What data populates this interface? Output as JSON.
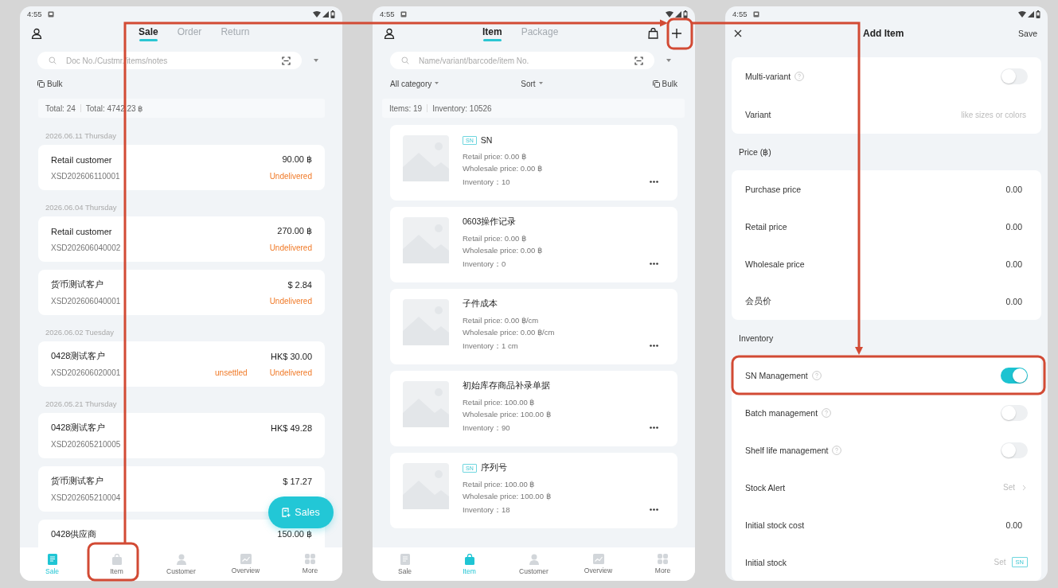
{
  "sales_screen": {
    "status_time": "4:55",
    "tabs": [
      {
        "label": "Sale",
        "selected": true
      },
      {
        "label": "Order",
        "selected": false
      },
      {
        "label": "Return",
        "selected": false
      }
    ],
    "search_placeholder": "Doc No./Custmr./items/notes",
    "bulk": "Bulk",
    "summary": [
      "Total: 24",
      "Total: 4742.23 ฿"
    ],
    "groups": [
      {
        "date": "2026.06.11 Thursday",
        "orders": [
          {
            "customer": "Retail customer",
            "amount": "90.00 ฿",
            "number": "XSD202606110001",
            "statuses": [
              "Undelivered"
            ]
          }
        ]
      },
      {
        "date": "2026.06.04 Thursday",
        "orders": [
          {
            "customer": "Retail customer",
            "amount": "270.00 ฿",
            "number": "XSD202606040002",
            "statuses": [
              "Undelivered"
            ]
          },
          {
            "customer": "货币测试客户",
            "amount": "$ 2.84",
            "number": "XSD202606040001",
            "statuses": [
              "Undelivered"
            ]
          }
        ]
      },
      {
        "date": "2026.06.02 Tuesday",
        "orders": [
          {
            "customer": "0428测试客户",
            "amount": "HK$ 30.00",
            "number": "XSD202606020001",
            "statuses": [
              "unsettled",
              "Undelivered"
            ]
          }
        ]
      },
      {
        "date": "2026.05.21 Thursday",
        "orders": [
          {
            "customer": "0428测试客户",
            "amount": "HK$ 49.28",
            "number": "XSD202605210005"
          },
          {
            "customer": "货币测试客户",
            "amount": "$ 17.27",
            "number": "XSD202605210004"
          },
          {
            "customer": "0428供应商",
            "amount": "150.00 ฿"
          }
        ]
      }
    ],
    "fab": "Sales",
    "nav": [
      {
        "label": "Sale",
        "selected": true
      },
      {
        "label": "Item",
        "selected": false
      },
      {
        "label": "Customer",
        "selected": false
      },
      {
        "label": "Overview",
        "selected": false
      },
      {
        "label": "More",
        "selected": false
      }
    ]
  },
  "items_screen": {
    "status_time": "4:55",
    "tabs": [
      {
        "label": "Item",
        "selected": true
      },
      {
        "label": "Package",
        "selected": false
      }
    ],
    "search_placeholder": "Name/variant/barcode/item No.",
    "filters": [
      "All category",
      "Sort"
    ],
    "bulk": "Bulk",
    "summary": [
      "Items: 19",
      "Inventory: 10526"
    ],
    "items": [
      {
        "badge": "SN",
        "name": "SN",
        "retail": "Retail price: 0.00 ฿",
        "wholesale": "Wholesale price: 0.00 ฿",
        "inventory": "Inventory：10"
      },
      {
        "name": "0603操作记录",
        "retail": "Retail price: 0.00 ฿",
        "wholesale": "Wholesale price: 0.00 ฿",
        "inventory": "Inventory：0"
      },
      {
        "name": "子件成本",
        "retail": "Retail price: 0.00 ฿/cm",
        "wholesale": "Wholesale price: 0.00 ฿/cm",
        "inventory": "Inventory：1 cm"
      },
      {
        "name": "初始库存商品补录单据",
        "retail": "Retail price: 100.00 ฿",
        "wholesale": "Wholesale price: 100.00 ฿",
        "inventory": "Inventory：90"
      },
      {
        "badge": "SN",
        "name": "序列号",
        "retail": "Retail price: 100.00 ฿",
        "wholesale": "Wholesale price: 100.00 ฿",
        "inventory": "Inventory：18"
      }
    ],
    "nav": [
      {
        "label": "Sale",
        "selected": false
      },
      {
        "label": "Item",
        "selected": true
      },
      {
        "label": "Customer",
        "selected": false
      },
      {
        "label": "Overview",
        "selected": false
      },
      {
        "label": "More",
        "selected": false
      }
    ]
  },
  "add_item_screen": {
    "status_time": "4:55",
    "title": "Add Item",
    "save": "Save",
    "sections": [
      {
        "rows": [
          {
            "kind": "toggle",
            "label": "Multi-variant",
            "help": true,
            "on": false
          },
          {
            "kind": "input",
            "label": "Variant",
            "help": false,
            "placeholder": "like sizes or colors"
          }
        ]
      },
      {
        "heading": "Price (฿)",
        "rows": [
          {
            "kind": "value",
            "label": "Purchase price",
            "help": false,
            "value": "0.00"
          },
          {
            "kind": "value",
            "label": "Retail price",
            "help": false,
            "value": "0.00"
          },
          {
            "kind": "value",
            "label": "Wholesale price",
            "help": false,
            "value": "0.00"
          },
          {
            "kind": "value",
            "label": "会员价",
            "help": false,
            "value": "0.00"
          }
        ]
      },
      {
        "heading": "Inventory",
        "rows": [
          {
            "kind": "toggle",
            "label": "SN Management",
            "help": true,
            "on": true
          },
          {
            "kind": "toggle",
            "label": "Batch management",
            "help": true,
            "on": false
          },
          {
            "kind": "toggle",
            "label": "Shelf life management",
            "help": true,
            "on": false
          },
          {
            "kind": "link",
            "label": "Stock Alert",
            "help": false,
            "value": "Set"
          },
          {
            "kind": "value",
            "label": "Initial stock cost",
            "help": false,
            "value": "0.00"
          },
          {
            "kind": "set",
            "label": "Initial stock",
            "help": false,
            "value": "Set",
            "badge": "SN"
          }
        ]
      }
    ]
  }
}
